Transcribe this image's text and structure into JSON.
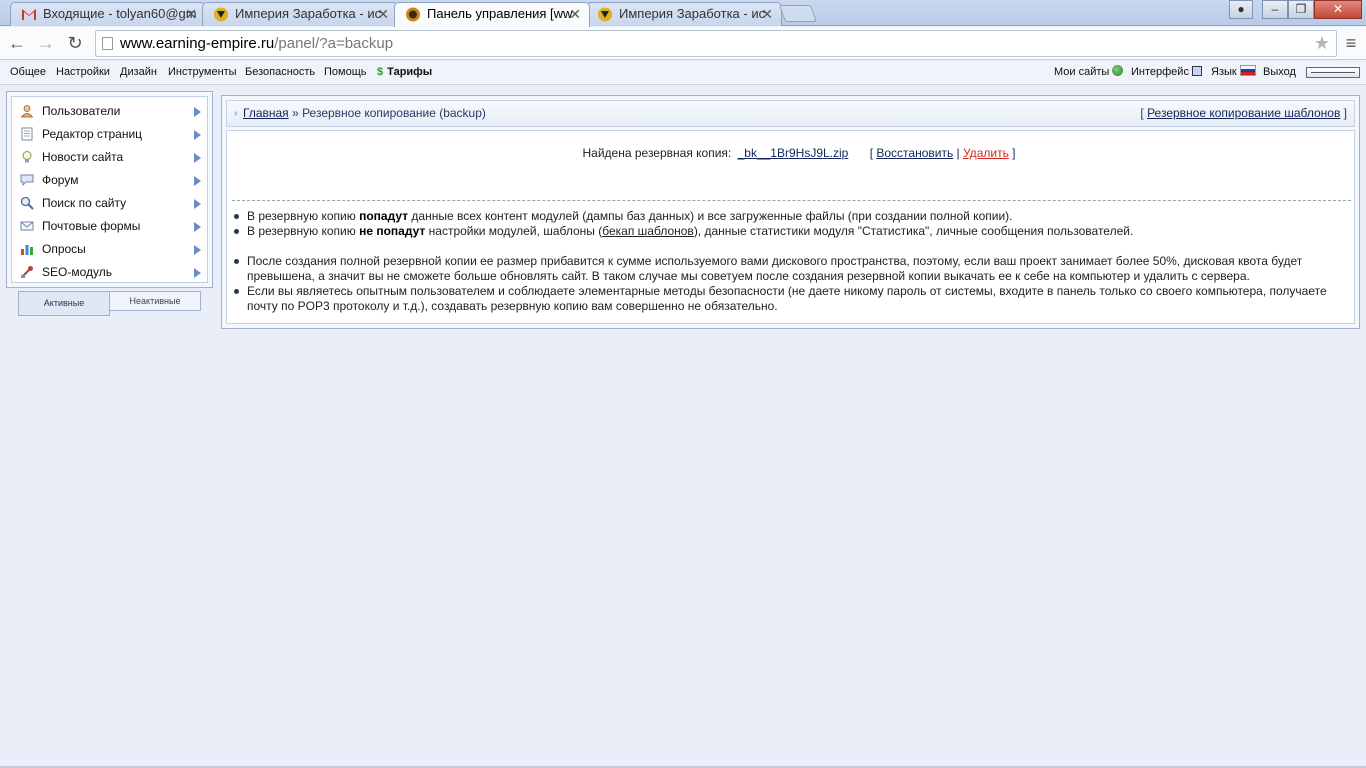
{
  "browser": {
    "tabs": [
      {
        "title": "Входящие - tolyan60@gm",
        "icon": "gmail-icon"
      },
      {
        "title": "Империя Заработка - ис",
        "icon": "empire-favicon"
      },
      {
        "title": "Панель управления [ww",
        "icon": "panel-favicon",
        "active": true
      },
      {
        "title": "Империя Заработка - ис",
        "icon": "empire-favicon"
      }
    ],
    "close_glyph": "✕",
    "url_host": "www.earning-empire.ru",
    "url_path": "/panel/?a=backup"
  },
  "menubar": {
    "left": [
      "Общее",
      "Настройки",
      "Дизайн",
      "Инструменты",
      "Безопасность",
      "Помощь"
    ],
    "tariffs": "Тарифы",
    "my_sites": "Мои сайты",
    "interface": "Интерфейс",
    "language": "Язык",
    "logout": "Выход"
  },
  "sidebar": {
    "items": [
      {
        "label": "Пользователи",
        "icon": "user-icon"
      },
      {
        "label": "Редактор страниц",
        "icon": "page-icon"
      },
      {
        "label": "Новости сайта",
        "icon": "bulb-icon"
      },
      {
        "label": "Форум",
        "icon": "chat-icon"
      },
      {
        "label": "Поиск по сайту",
        "icon": "search-icon"
      },
      {
        "label": "Почтовые формы",
        "icon": "mail-icon"
      },
      {
        "label": "Опросы",
        "icon": "chart-icon"
      },
      {
        "label": "SEO-модуль",
        "icon": "seo-icon"
      }
    ],
    "tab_active": "Активные",
    "tab_inactive": "Неактивные"
  },
  "main": {
    "crumb_home": "Главная",
    "crumb_sep": "»",
    "crumb_current": "Резервное копирование (backup)",
    "templates_link": "Резервное копирование шаблонов",
    "found_label": "Найдена резервная копия:",
    "backup_file": "_bk__1Br9HsJ9L.zip",
    "restore": "Восстановить",
    "delete": "Удалить",
    "note1_pre": "В резервную копию",
    "note1_bold": "попадут",
    "note1_post": "данные всех контент модулей (дампы баз данных) и все загруженные файлы (при создании полной копии).",
    "note2_pre": "В резервную копию",
    "note2_bold": "не попадут",
    "note2_mid": "настройки модулей, шаблоны (",
    "note2_link": "бекап шаблонов",
    "note2_post": "), данные статистики модуля \"Статистика\", личные сообщения пользователей.",
    "note3": "После создания полной резервной копии ее размер прибавится к сумме используемого вами дискового пространства, поэтому, если ваш проект занимает более 50%, дисковая квота будет превышена, а значит вы не сможете больше обновлять сайт. В таком случае мы советуем после создания резервной копии выкачать ее к себе на компьютер и удалить с сервера.",
    "note4": "Если вы являетесь опытным пользователем и соблюдаете элементарные методы безопасности (не даете никому пароль от системы, входите в панель только со своего компьютера, получаете почту по POP3 протоколу и т.д.), создавать резервную копию вам совершенно не обязательно."
  },
  "colors": {
    "page_bg": "#e9eef8",
    "link": "#13265a",
    "delete_link": "#d3281e",
    "tariff_dollar": "#2b9a2b"
  }
}
